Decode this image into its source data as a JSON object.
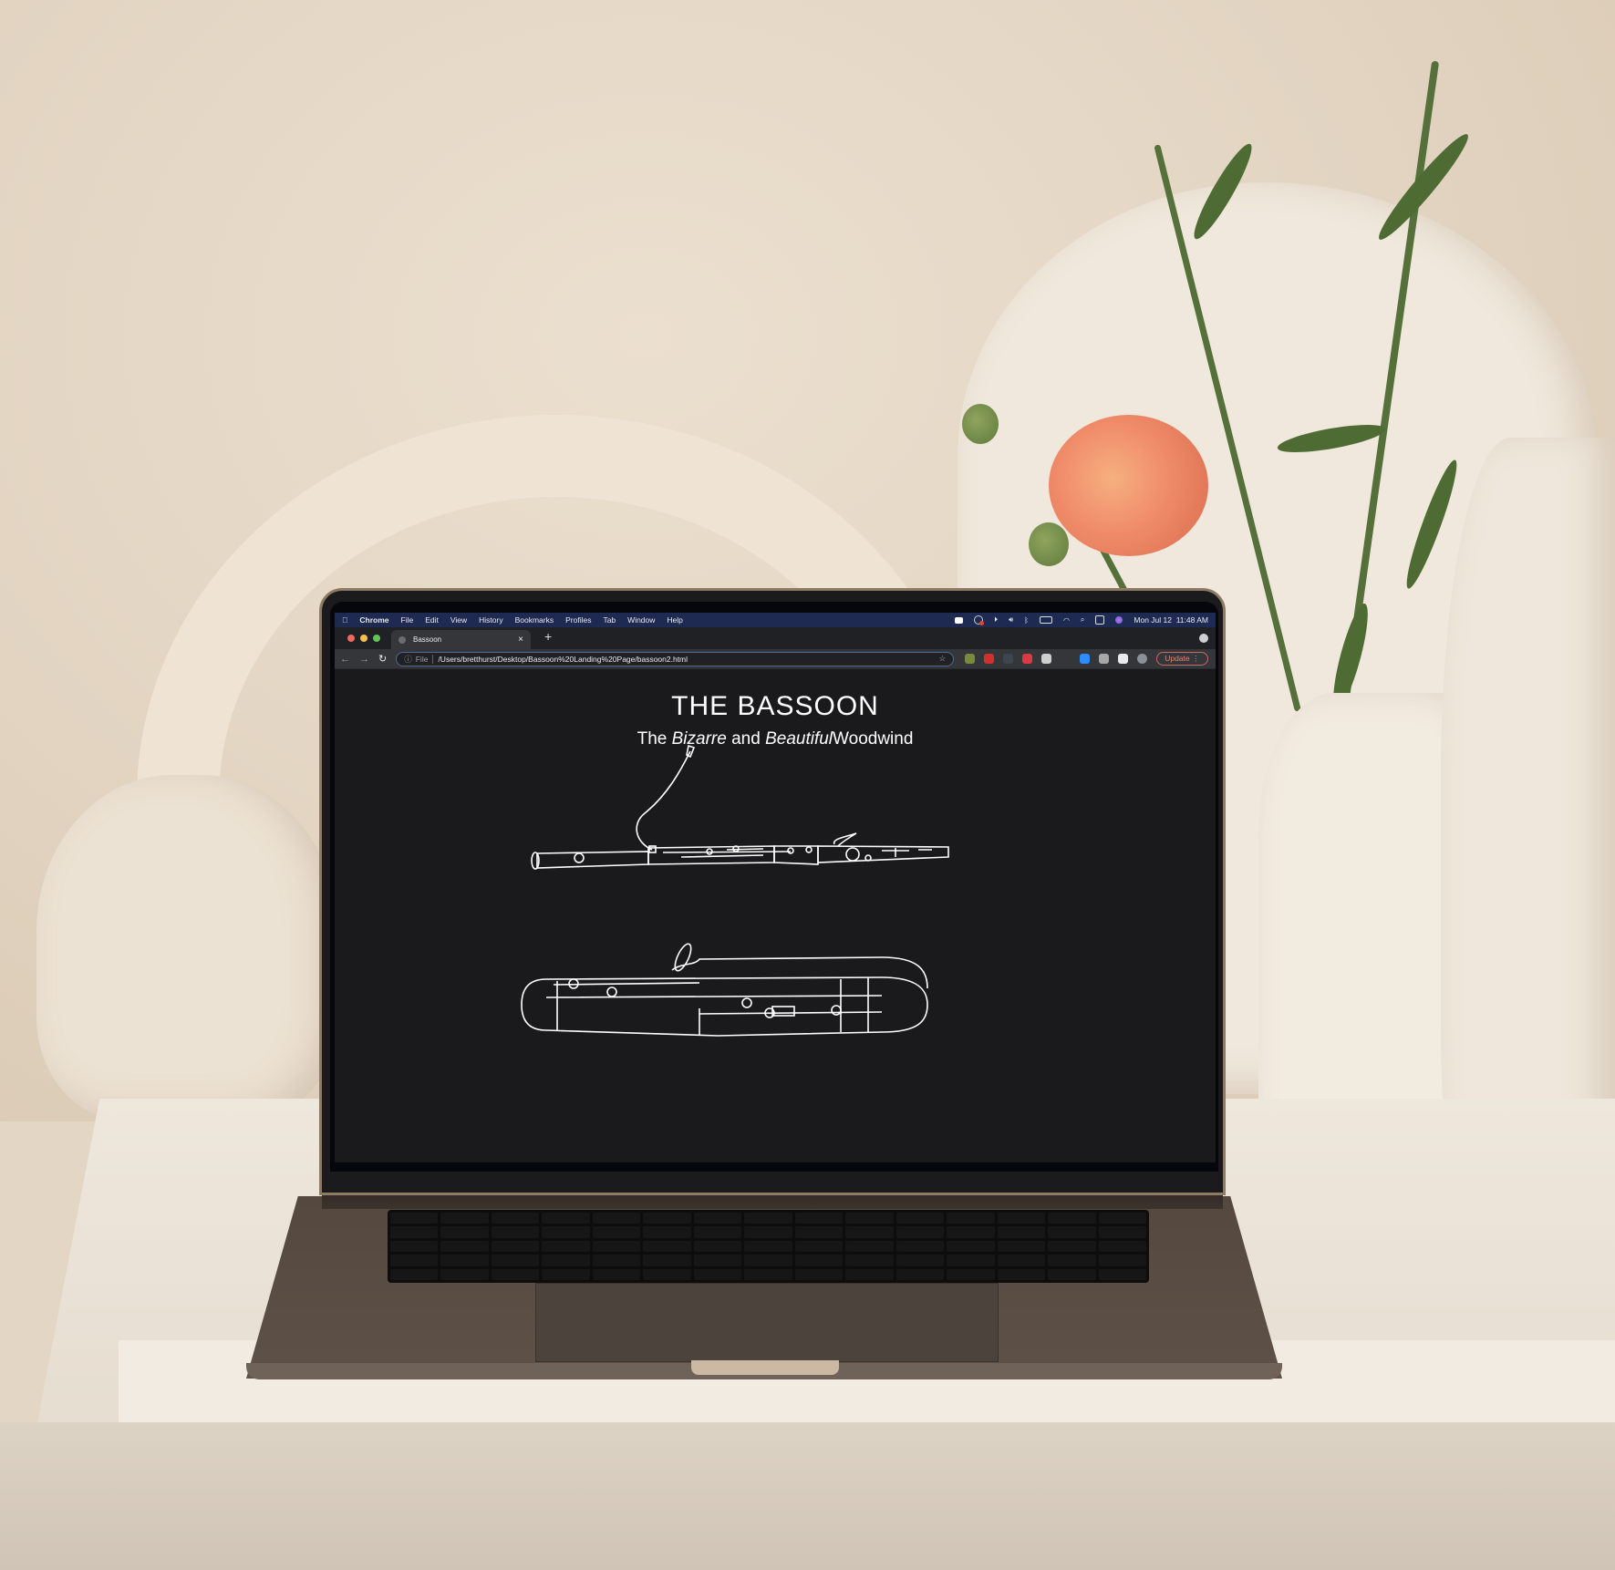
{
  "menubar": {
    "apple": "",
    "app": "Chrome",
    "items": [
      "File",
      "Edit",
      "View",
      "History",
      "Bookmarks",
      "Profiles",
      "Tab",
      "Window",
      "Help"
    ],
    "status_icons": [
      "zoom-icon",
      "screen-record-icon",
      "play-icon",
      "volume-icon",
      "bluetooth-icon",
      "battery-icon",
      "wifi-icon",
      "search-icon",
      "control-center-icon",
      "siri-icon"
    ],
    "clock": "Mon Jul 12  11:48 AM"
  },
  "browser": {
    "tab_title": "Bassoon",
    "tab_close": "×",
    "new_tab": "+",
    "back": "←",
    "forward": "→",
    "reload": "↻",
    "info": "ⓘ",
    "scheme_label": "File",
    "url": "/Users/bretthurst/Desktop/Bassoon%20Landing%20Page/bassoon2.html",
    "star": "☆",
    "extensions": [
      {
        "name": "eyedropper-extension-icon",
        "color": "#7a8a3c"
      },
      {
        "name": "red-extension-icon",
        "color": "#d22f2f"
      },
      {
        "name": "dots-extension-icon",
        "color": "#3c4650"
      },
      {
        "name": "adblock-extension-icon",
        "color": "#d83a45"
      },
      {
        "name": "document-extension-icon",
        "color": "#cfcfcf"
      },
      {
        "name": "blank-extension-icon",
        "color": "#35363a"
      },
      {
        "name": "zoom-extension-icon",
        "color": "#2d8cff"
      },
      {
        "name": "grey-extension-icon",
        "color": "#a8a8a8"
      },
      {
        "name": "puzzle-extensions-icon",
        "color": "#e8eaed"
      },
      {
        "name": "profile-avatar-icon",
        "color": "#8a8f99"
      }
    ],
    "update_label": "Update",
    "menu_dots": "⋮"
  },
  "page": {
    "title": "THE BASSOON",
    "subtitle": {
      "the": "The",
      "bizarre": "Bizarre",
      "and": "and",
      "beautiful": "Beautiful",
      "woodwind": "Woodwind"
    },
    "illustrations": [
      "bassoon-side-view",
      "contrabassoon-side-view"
    ]
  },
  "colors": {
    "page_bg": "#1a1a1c",
    "menubar_bg": "#1f2a52",
    "update_accent": "#e3847c",
    "traffic_red": "#ed6a5e",
    "traffic_yellow": "#f5bf4f",
    "traffic_green": "#61c554"
  }
}
